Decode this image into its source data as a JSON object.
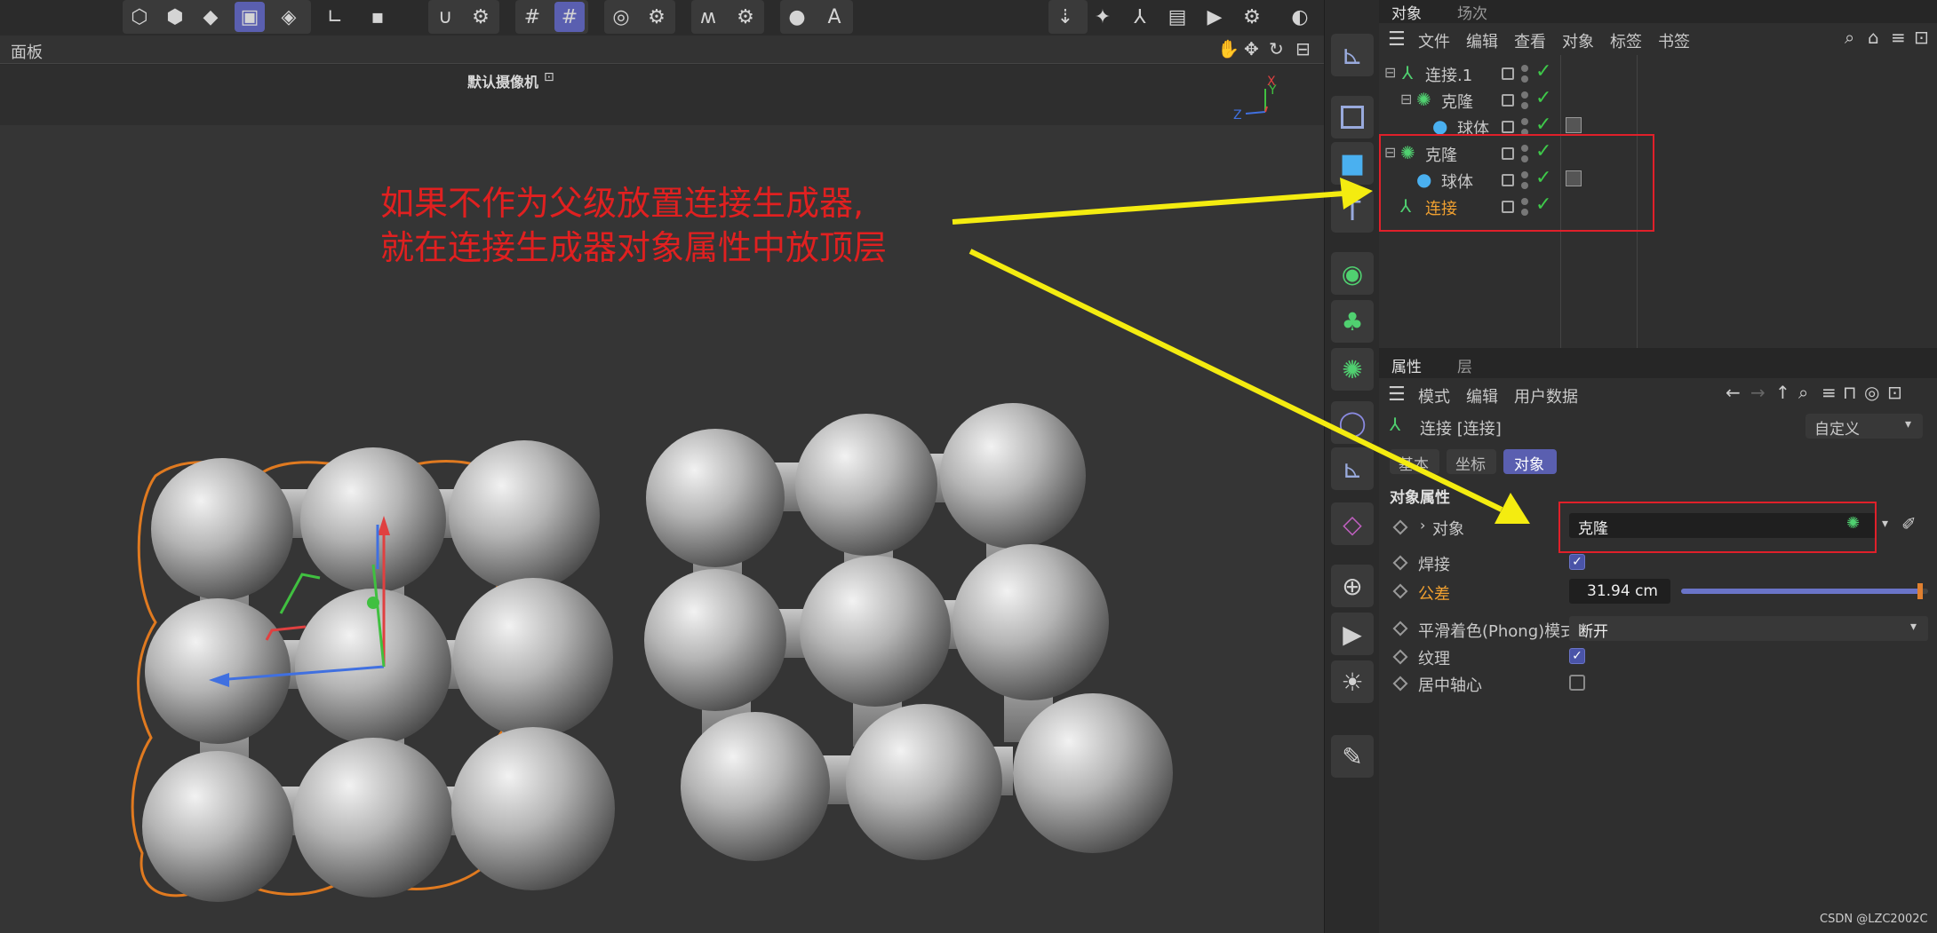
{
  "panel": {
    "title": "面板",
    "camera_label": "默认摄像机"
  },
  "axis": {
    "x": "X",
    "y": "Y",
    "z": "Z"
  },
  "annotation": {
    "line1": "如果不作为父级放置连接生成器,",
    "line2": "就在连接生成器对象属性中放顶层",
    "color": "#e02020",
    "arrow_color": "#f4ec10"
  },
  "objects_panel": {
    "tabs": [
      "对象",
      "场次"
    ],
    "menu": [
      "文件",
      "编辑",
      "查看",
      "对象",
      "标签",
      "书签"
    ],
    "tree": [
      {
        "name": "连接.1",
        "icon": "connect-icon",
        "depth": 0,
        "highlight": false
      },
      {
        "name": "克隆",
        "icon": "cloner-icon",
        "depth": 1,
        "highlight": false
      },
      {
        "name": "球体",
        "icon": "sphere-icon",
        "depth": 2,
        "highlight": false
      },
      {
        "name": "克隆",
        "icon": "cloner-icon",
        "depth": 0,
        "highlight": false
      },
      {
        "name": "球体",
        "icon": "sphere-icon",
        "depth": 1,
        "highlight": false
      },
      {
        "name": "连接",
        "icon": "connect-icon",
        "depth": 0,
        "highlight": true
      }
    ]
  },
  "attributes_panel": {
    "tabs": [
      "属性",
      "层"
    ],
    "menu": [
      "模式",
      "编辑",
      "用户数据"
    ],
    "object_title": "连接 [连接]",
    "preset": "自定义",
    "subtabs": [
      "基本",
      "坐标",
      "对象"
    ],
    "active_subtab": "对象",
    "section": "对象属性",
    "fields": {
      "object_label": "对象",
      "object_value": "克隆",
      "weld_label": "焊接",
      "weld_checked": true,
      "tolerance_label": "公差",
      "tolerance_value": "31.94 cm",
      "tolerance_fill": 0.98,
      "phong_label": "平滑着色(Phong)模式",
      "phong_value": "断开",
      "texture_label": "纹理",
      "texture_checked": true,
      "center_label": "居中轴心",
      "center_checked": false
    }
  },
  "watermark": "CSDN @LZC2002C",
  "colors": {
    "accent": "#5a5fb0",
    "highlight_box": "#e0202a",
    "orange_text": "#f0a030",
    "selection_outline": "#e07a20"
  }
}
